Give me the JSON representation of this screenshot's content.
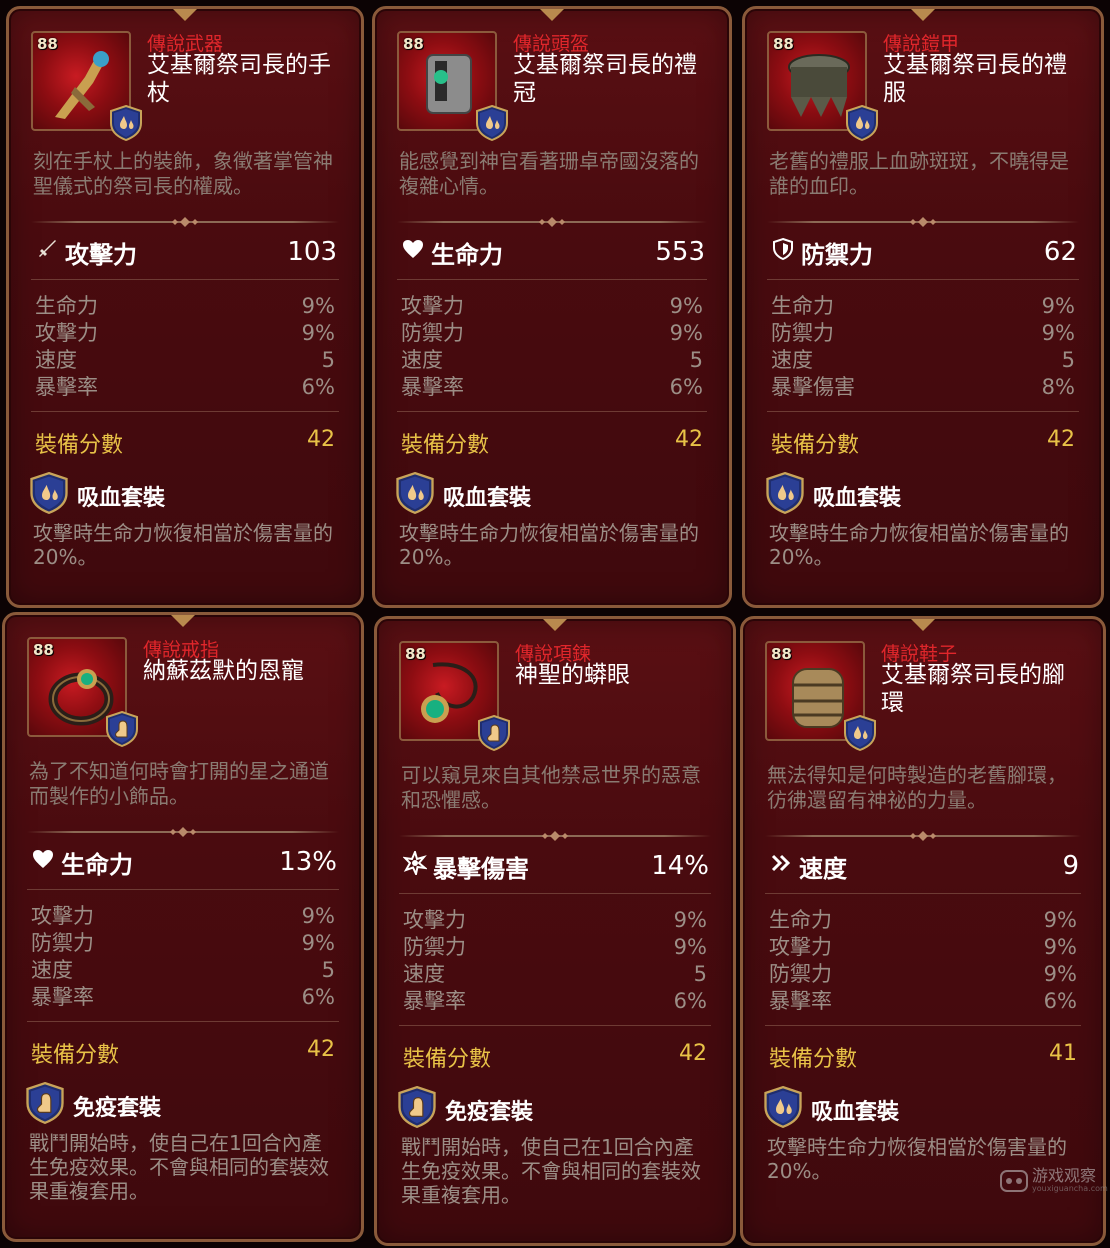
{
  "cards": [
    {
      "level": "88",
      "grade": "傳說武器",
      "name": "艾基爾祭司長的手杖",
      "description": "刻在手杖上的裝飾，象徵著掌管神聖儀式的祭司長的權威。",
      "main_stat": {
        "icon": "sword-icon",
        "label": "攻擊力",
        "value": "103"
      },
      "substats": [
        {
          "label": "生命力",
          "value": "9%"
        },
        {
          "label": "攻擊力",
          "value": "9%"
        },
        {
          "label": "速度",
          "value": "5"
        },
        {
          "label": "暴擊率",
          "value": "6%"
        }
      ],
      "score_label": "裝備分數",
      "score": "42",
      "set": {
        "icon": "lifesteal-set-icon",
        "name": "吸血套裝",
        "description": "攻擊時生命力恢復相當於傷害量的20%。"
      }
    },
    {
      "level": "88",
      "grade": "傳說頭盔",
      "name": "艾基爾祭司長的禮冠",
      "description": "能感覺到神官看著珊卓帝國沒落的複雜心情。",
      "main_stat": {
        "icon": "heart-icon",
        "label": "生命力",
        "value": "553"
      },
      "substats": [
        {
          "label": "攻擊力",
          "value": "9%"
        },
        {
          "label": "防禦力",
          "value": "9%"
        },
        {
          "label": "速度",
          "value": "5"
        },
        {
          "label": "暴擊率",
          "value": "6%"
        }
      ],
      "score_label": "裝備分數",
      "score": "42",
      "set": {
        "icon": "lifesteal-set-icon",
        "name": "吸血套裝",
        "description": "攻擊時生命力恢復相當於傷害量的20%。"
      }
    },
    {
      "level": "88",
      "grade": "傳說鎧甲",
      "name": "艾基爾祭司長的禮服",
      "description": "老舊的禮服上血跡斑斑，不曉得是誰的血印。",
      "main_stat": {
        "icon": "shield-icon",
        "label": "防禦力",
        "value": "62"
      },
      "substats": [
        {
          "label": "生命力",
          "value": "9%"
        },
        {
          "label": "防禦力",
          "value": "9%"
        },
        {
          "label": "速度",
          "value": "5"
        },
        {
          "label": "暴擊傷害",
          "value": "8%"
        }
      ],
      "score_label": "裝備分數",
      "score": "42",
      "set": {
        "icon": "lifesteal-set-icon",
        "name": "吸血套裝",
        "description": "攻擊時生命力恢復相當於傷害量的20%。"
      }
    },
    {
      "level": "88",
      "grade": "傳說戒指",
      "name": "納蘇茲默的恩寵",
      "description": "為了不知道何時會打開的星之通道而製作的小飾品。",
      "main_stat": {
        "icon": "heart-icon",
        "label": "生命力",
        "value": "13%"
      },
      "substats": [
        {
          "label": "攻擊力",
          "value": "9%"
        },
        {
          "label": "防禦力",
          "value": "9%"
        },
        {
          "label": "速度",
          "value": "5"
        },
        {
          "label": "暴擊率",
          "value": "6%"
        }
      ],
      "score_label": "裝備分數",
      "score": "42",
      "set": {
        "icon": "immunity-set-icon",
        "name": "免疫套裝",
        "description": "戰鬥開始時，使自己在1回合內產生免疫效果。不會與相同的套裝效果重複套用。"
      }
    },
    {
      "level": "88",
      "grade": "傳說項鍊",
      "name": "神聖的蟒眼",
      "description": "可以窺見來自其他禁忌世界的惡意和恐懼感。",
      "main_stat": {
        "icon": "crit-damage-icon",
        "label": "暴擊傷害",
        "value": "14%"
      },
      "substats": [
        {
          "label": "攻擊力",
          "value": "9%"
        },
        {
          "label": "防禦力",
          "value": "9%"
        },
        {
          "label": "速度",
          "value": "5"
        },
        {
          "label": "暴擊率",
          "value": "6%"
        }
      ],
      "score_label": "裝備分數",
      "score": "42",
      "set": {
        "icon": "immunity-set-icon",
        "name": "免疫套裝",
        "description": "戰鬥開始時，使自己在1回合內產生免疫效果。不會與相同的套裝效果重複套用。"
      }
    },
    {
      "level": "88",
      "grade": "傳說鞋子",
      "name": "艾基爾祭司長的腳環",
      "description": "無法得知是何時製造的老舊腳環，彷彿還留有神祕的力量。",
      "main_stat": {
        "icon": "speed-icon",
        "label": "速度",
        "value": "9"
      },
      "substats": [
        {
          "label": "生命力",
          "value": "9%"
        },
        {
          "label": "攻擊力",
          "value": "9%"
        },
        {
          "label": "防禦力",
          "value": "9%"
        },
        {
          "label": "暴擊率",
          "value": "6%"
        }
      ],
      "score_label": "裝備分數",
      "score": "41",
      "set": {
        "icon": "lifesteal-set-icon",
        "name": "吸血套裝",
        "description": "攻擊時生命力恢復相當於傷害量的20%。"
      }
    }
  ],
  "watermark": {
    "text": "游戏观察",
    "sub": "youxiguancha.com"
  },
  "colors": {
    "grade_red": "#e0262b",
    "score_gold": "#e8c247",
    "card_bg": "#4a0b0f",
    "border": "#8a5a3a"
  }
}
